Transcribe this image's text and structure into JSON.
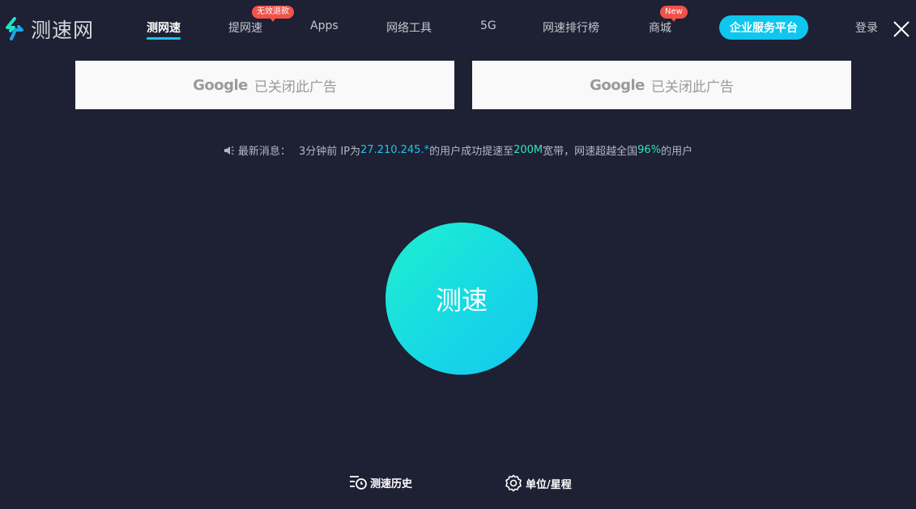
{
  "header": {
    "logo_text": "测速网",
    "nav": [
      {
        "label": "测网速",
        "active": true
      },
      {
        "label": "提网速",
        "badge": "无效退款"
      },
      {
        "label": "Apps"
      },
      {
        "label": "网络工具"
      },
      {
        "label": "5G"
      },
      {
        "label": "网速排行榜"
      },
      {
        "label": "商城",
        "badge": "New"
      }
    ],
    "enterprise_button": "企业服务平台",
    "login": "登录"
  },
  "ads": [
    {
      "brand": "Google",
      "text": "已关闭此广告"
    },
    {
      "brand": "Google",
      "text": "已关闭此广告"
    }
  ],
  "news": {
    "label": "最新消息：",
    "time": "3分钟前 IP为",
    "ip": "27.210.245.*",
    "mid": "的用户成功提速至",
    "speed": "200M",
    "mid2": "宽带，网速超越全国",
    "percent": "96%",
    "tail": "的用户"
  },
  "start_button": "测速",
  "footer": {
    "history": "测速历史",
    "units": "单位/星程"
  },
  "colors": {
    "background": "#1e2033",
    "accent": "#0fc6ee",
    "badge": "#f1524a",
    "highlight_blue": "#1fc5ee",
    "highlight_green": "#2ee5bd"
  }
}
